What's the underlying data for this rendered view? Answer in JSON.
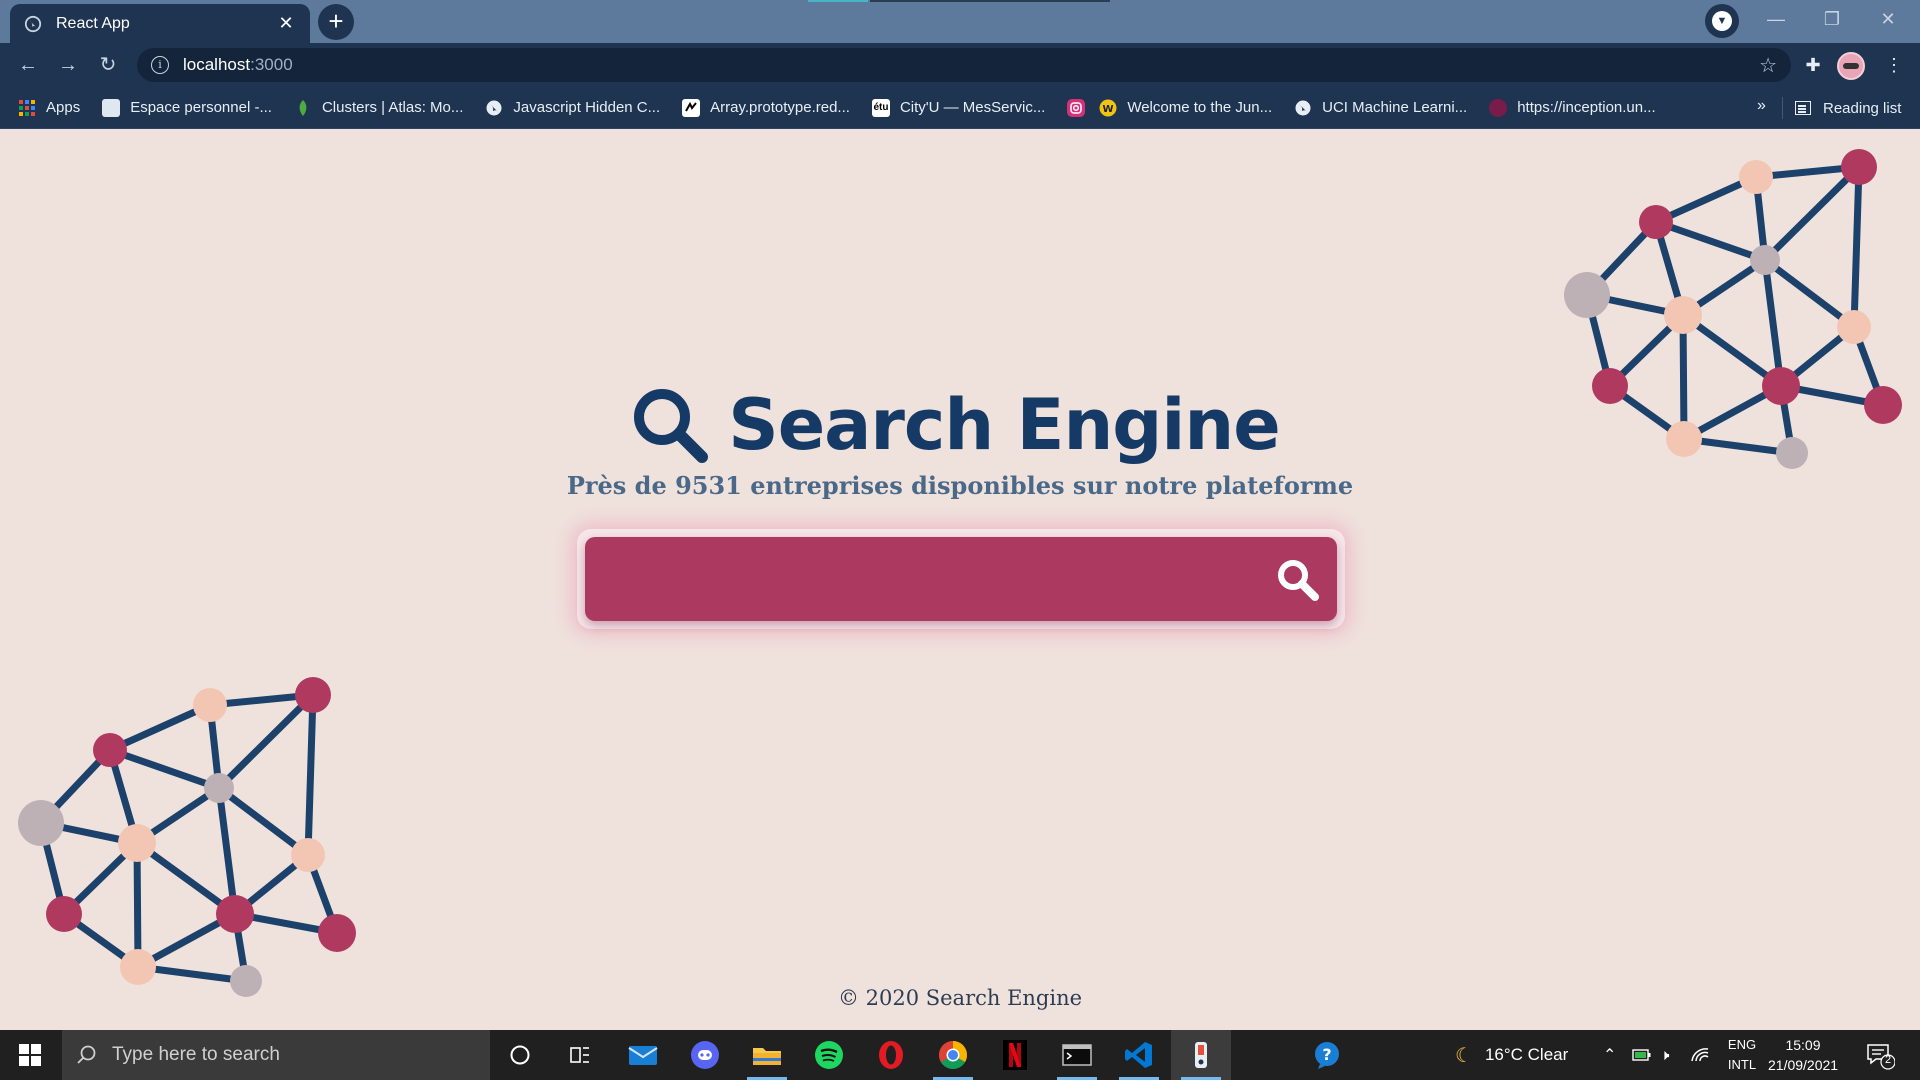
{
  "browser": {
    "tab_title": "React App",
    "tab_close": "✕",
    "new_tab": "+",
    "url_host": "localhost",
    "url_port": ":3000",
    "bookmarks": [
      {
        "label": "Apps",
        "color": "#e24a3b",
        "icon": "apps-grid-icon"
      },
      {
        "label": "Espace personnel -...",
        "color": "#ffffff",
        "icon": "espace-personnel-icon"
      },
      {
        "label": "Clusters | Atlas: Mo...",
        "color": "#4faa41",
        "icon": "mongodb-leaf-icon"
      },
      {
        "label": "Javascript Hidden C...",
        "color": "#9aa6b3",
        "icon": "globe-icon"
      },
      {
        "label": "Array.prototype.red...",
        "color": "#ffffff",
        "icon": "mdn-icon"
      },
      {
        "label": "City'U — MesServic...",
        "color": "#ffffff",
        "icon": "etu-icon"
      },
      {
        "label": "",
        "color": "#d6307a",
        "icon": "instagram-icon"
      },
      {
        "label": "Welcome to the Jun...",
        "color": "#f1c40f",
        "icon": "junior-icon"
      },
      {
        "label": "UCI Machine Learni...",
        "color": "#9aa6b3",
        "icon": "globe-icon"
      },
      {
        "label": "https://inception.un...",
        "color": "#7a1c4a",
        "icon": "inception-icon"
      }
    ],
    "bookmarks_more": "»",
    "reading_list": "Reading list"
  },
  "page": {
    "title": "Search Engine",
    "subtitle": "Près de 9531 entreprises disponibles sur notre plateforme",
    "search_value": "",
    "footer": "© 2020 Search Engine",
    "colors": {
      "title": "#163a66",
      "search_bar": "#ac3a60",
      "node_pink": "#b0395f",
      "node_peach": "#f3c6b3",
      "node_grey": "#bdb1b6",
      "edge": "#1c416b"
    }
  },
  "taskbar": {
    "search_placeholder": "Type here to search",
    "weather": "16°C  Clear",
    "lang_top": "ENG",
    "lang_bottom": "INTL",
    "time": "15:09",
    "date": "21/09/2021",
    "notification_count": "2"
  }
}
